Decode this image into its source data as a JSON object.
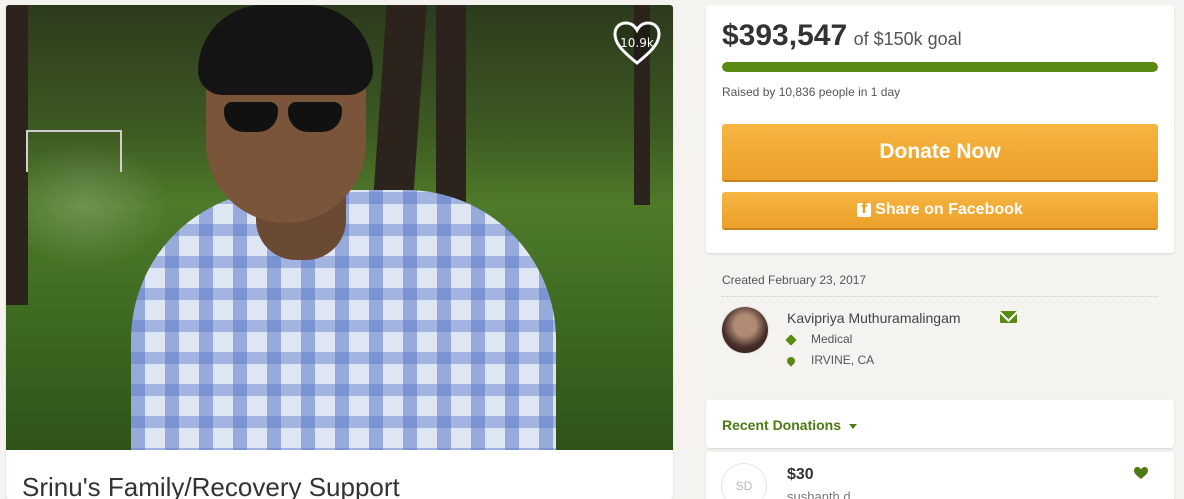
{
  "campaign": {
    "title": "Srinu's Family/Recovery Support",
    "heart_count": "10.9k"
  },
  "funding": {
    "raised_amount": "$393,547",
    "goal_text": "of $150k goal",
    "progress_percent": 100,
    "raised_summary": "Raised by 10,836 people in 1 day",
    "donate_label": "Donate Now",
    "share_label": "Share on Facebook"
  },
  "details": {
    "created": "Created February 23, 2017",
    "organizer_name": "Kavipriya Muthuramalingam",
    "category": "Medical",
    "location": "IRVINE, CA"
  },
  "donations": {
    "title": "Recent Donations",
    "items": [
      {
        "initials": "SD",
        "amount": "$30",
        "name": "sushanth d"
      }
    ]
  },
  "icons": {
    "heart": "heart-icon",
    "facebook": "facebook-icon",
    "mail": "mail-icon",
    "tag": "tag-icon",
    "location": "map-marker-icon",
    "caret": "caret-down-icon"
  },
  "colors": {
    "accent_green": "#5b8a13",
    "donate_orange": "#eba02a"
  }
}
